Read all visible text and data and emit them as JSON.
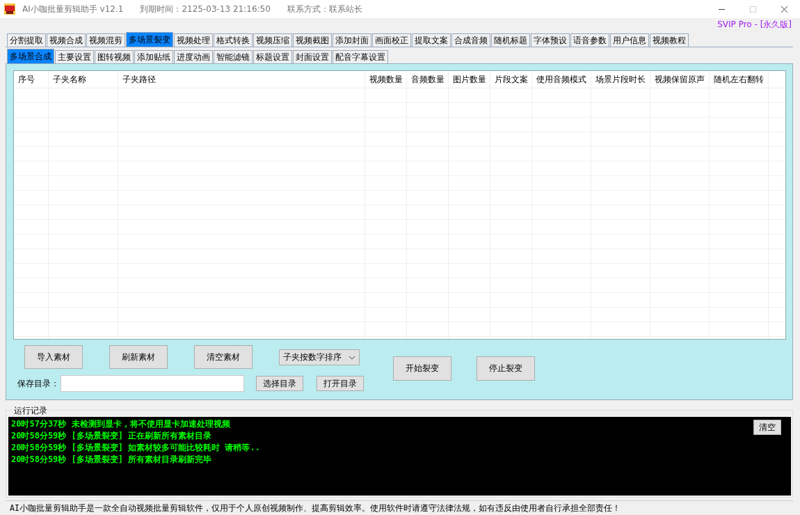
{
  "window": {
    "title": "AI小咖批量剪辑助手 v12.1",
    "expiry": "到期时间：2125-03-13 21:16:50",
    "contact": "联系方式：联系站长"
  },
  "license": "SVIP Pro - [永久版]",
  "tabs": [
    {
      "label": "分割提取",
      "selected": false
    },
    {
      "label": "视频合成",
      "selected": false
    },
    {
      "label": "视频混剪",
      "selected": false
    },
    {
      "label": "多场景裂变",
      "selected": true
    },
    {
      "label": "视频处理",
      "selected": false
    },
    {
      "label": "格式转换",
      "selected": false
    },
    {
      "label": "视频压缩",
      "selected": false
    },
    {
      "label": "视频截图",
      "selected": false
    },
    {
      "label": "添加封面",
      "selected": false
    },
    {
      "label": "画面校正",
      "selected": false
    },
    {
      "label": "提取文案",
      "selected": false
    },
    {
      "label": "合成音频",
      "selected": false
    },
    {
      "label": "随机标题",
      "selected": false
    },
    {
      "label": "字体预设",
      "selected": false
    },
    {
      "label": "语音参数",
      "selected": false
    },
    {
      "label": "用户信息",
      "selected": false
    },
    {
      "label": "视频教程",
      "selected": false
    }
  ],
  "subtabs": [
    {
      "label": "多场景合成",
      "selected": true
    },
    {
      "label": "主要设置",
      "selected": false
    },
    {
      "label": "图转视频",
      "selected": false
    },
    {
      "label": "添加贴纸",
      "selected": false
    },
    {
      "label": "进度动画",
      "selected": false
    },
    {
      "label": "智能滤镜",
      "selected": false
    },
    {
      "label": "标题设置",
      "selected": false
    },
    {
      "label": "封面设置",
      "selected": false
    },
    {
      "label": "配音字幕设置",
      "selected": false
    }
  ],
  "table": {
    "columns": [
      "序号",
      "子夹名称",
      "子夹路径",
      "视频数量",
      "音频数量",
      "图片数量",
      "片段文案",
      "使用音频模式",
      "场景片段时长",
      "视频保留原声",
      "随机左右翻转"
    ]
  },
  "material_buttons": [
    "导入素材",
    "刷新素材",
    "清空素材"
  ],
  "sort_dropdown": {
    "value": "子夹按数字排序"
  },
  "action_buttons": [
    "开始裂变",
    "停止裂变"
  ],
  "save_dir": {
    "label": "保存目录：",
    "buttons": [
      "选择目录",
      "打开目录"
    ]
  },
  "log": {
    "title": "运行记录",
    "clear_button": "清空",
    "lines": [
      "20时57分37秒 未检测到显卡，将不使用显卡加速处理视频",
      "20时58分59秒 [多场景裂变] 正在刷新所有素材目录",
      "20时58分59秒 [多场景裂变] 如素材较多可能比较耗时 请稍等..",
      "20时58分59秒 [多场景裂变] 所有素材目录刷新完毕"
    ]
  },
  "status_bar": "AI小咖批量剪辑助手是一款全自动视频批量剪辑软件，仅用于个人原创视频制作、提高剪辑效率。使用软件时请遵守法律法规，如有违反由使用者自行承担全部责任！"
}
